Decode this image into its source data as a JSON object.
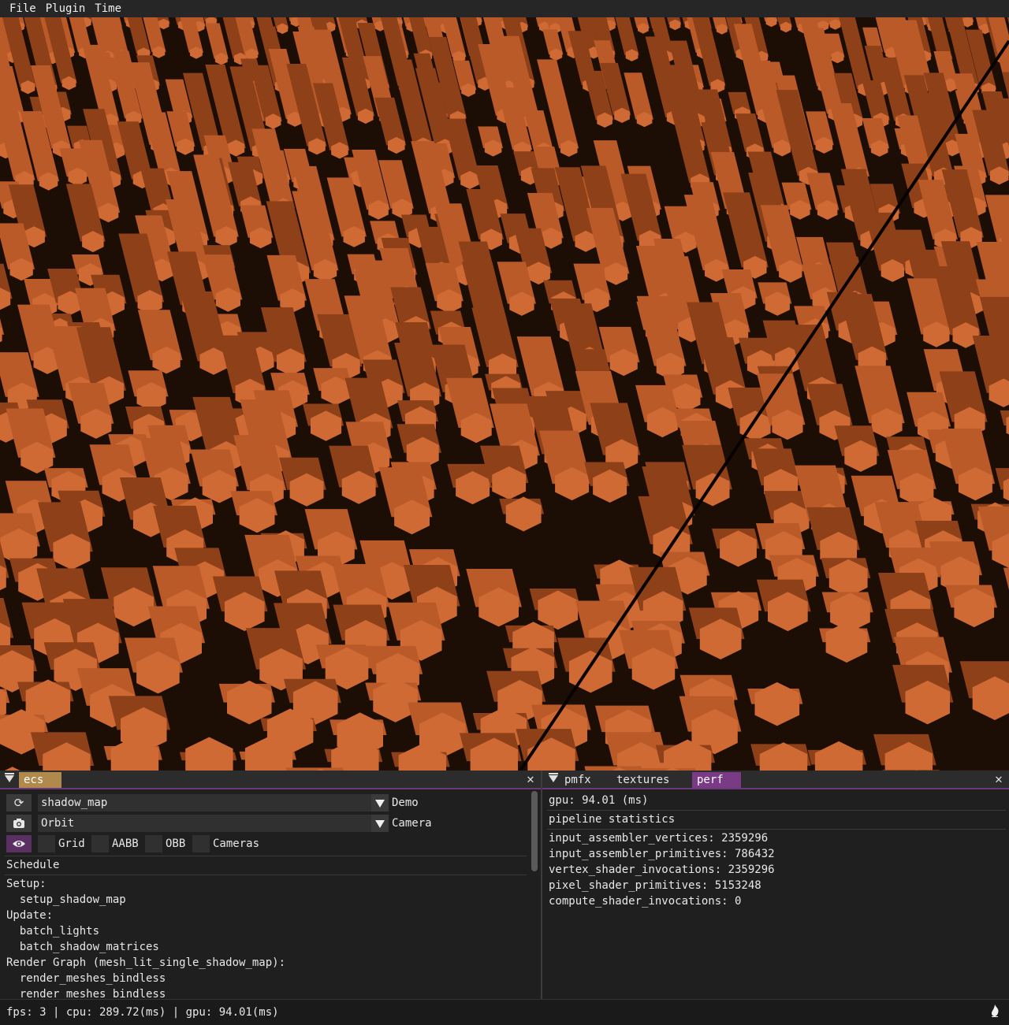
{
  "menu": {
    "file": "File",
    "plugin": "Plugin",
    "time": "Time"
  },
  "viewport": {
    "ground_color": "#1c0d05",
    "pillar_top": "#cf6a34",
    "pillar_side": "#b95a28",
    "pillar_dark": "#8e4018"
  },
  "ecs_panel": {
    "tab": "ecs",
    "shadow_combo": {
      "value": "shadow_map",
      "label": "Demo"
    },
    "camera_combo": {
      "value": "Orbit",
      "label": "Camera"
    },
    "checks": {
      "grid": "Grid",
      "aabb": "AABB",
      "obb": "OBB",
      "cameras": "Cameras"
    },
    "schedule_header": "Schedule",
    "lines": [
      "Setup:",
      "  setup_shadow_map",
      "Update:",
      "  batch_lights",
      "  batch_shadow_matrices",
      "Render Graph (mesh_lit_single_shadow_map):",
      "  render_meshes_bindless",
      "  render_meshes_bindless"
    ]
  },
  "right_panel": {
    "tabs": {
      "pmfx": "pmfx",
      "textures": "textures",
      "perf": "perf"
    },
    "gpu": "gpu: 94.01 (ms)",
    "pipeline_header": "pipeline statistics",
    "stats": [
      "input_assembler_vertices: 2359296",
      "input_assembler_primitives: 786432",
      "vertex_shader_invocations: 2359296",
      "pixel_shader_primitives: 5153248",
      "compute_shader_invocations: 0"
    ]
  },
  "status": {
    "text": "fps: 3 | cpu: 289.72(ms) | gpu: 94.01(ms)"
  }
}
